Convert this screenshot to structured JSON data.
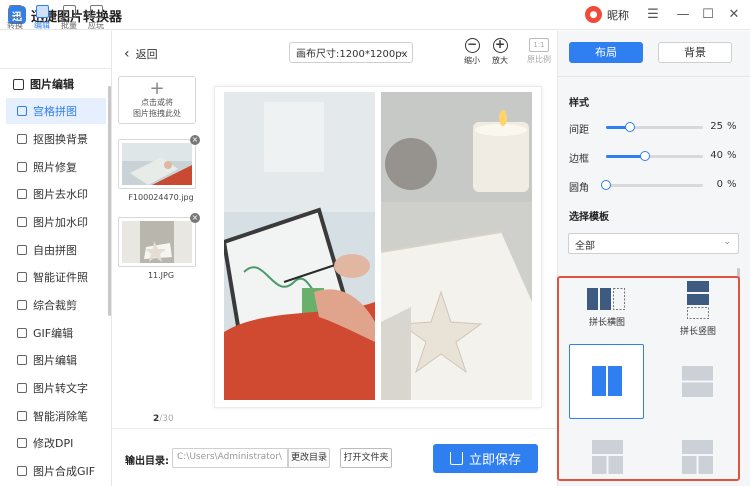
{
  "app": {
    "title": "迅捷图片转换器",
    "logo_glyph": "迅",
    "user_name": "昵称",
    "avatar_glyph": "●"
  },
  "window": {
    "menu_glyph": "☰",
    "minimize_glyph": "—",
    "maximize_glyph": "☐",
    "close_glyph": "✕"
  },
  "top_icons": [
    {
      "label": "转换",
      "icon": "convert-icon"
    },
    {
      "label": "编辑",
      "icon": "edit-icon",
      "active": true
    },
    {
      "label": "批量",
      "icon": "batch-icon"
    },
    {
      "label": "应玩",
      "icon": "fun-icon"
    }
  ],
  "sidebar": {
    "section_title": "图片编辑",
    "items": [
      {
        "label": "宫格拼图",
        "icon": "grid-icon",
        "active": true
      },
      {
        "label": "抠图换背景",
        "icon": "cutout-icon"
      },
      {
        "label": "照片修复",
        "icon": "repair-icon"
      },
      {
        "label": "图片去水印",
        "icon": "remove-watermark-icon"
      },
      {
        "label": "图片加水印",
        "icon": "add-watermark-icon"
      },
      {
        "label": "自由拼图",
        "icon": "free-collage-icon"
      },
      {
        "label": "智能证件照",
        "icon": "id-photo-icon"
      },
      {
        "label": "综合裁剪",
        "icon": "crop-icon"
      },
      {
        "label": "GIF编辑",
        "icon": "gif-icon"
      },
      {
        "label": "图片编辑",
        "icon": "image-edit-icon"
      },
      {
        "label": "图片转文字",
        "icon": "ocr-icon"
      },
      {
        "label": "智能消除笔",
        "icon": "eraser-icon"
      },
      {
        "label": "修改DPI",
        "icon": "dpi-icon"
      },
      {
        "label": "图片合成GIF",
        "icon": "make-gif-icon"
      }
    ]
  },
  "toolbar": {
    "back_label": "返回",
    "back_glyph": "‹",
    "canvas_size": "画布尺寸:1200*1200px",
    "chev": "⌄",
    "zoom_out_label": "缩小",
    "zoom_in_label": "放大",
    "ratio_box": "1:1",
    "ratio_label": "原比例",
    "minus": "−",
    "plus": "+"
  },
  "thumbnails": {
    "add_text": "点击或将\n图片拖拽此处",
    "plus": "+",
    "close": "×",
    "files": [
      "F100024470.jpg",
      "11.JPG"
    ],
    "page_current": "2",
    "page_total": "/30"
  },
  "output": {
    "label": "输出目录:",
    "path": "C:\\Users\\Administrator\\",
    "change_label": "更改目录",
    "open_label": "打开文件夹",
    "save_label": "立即保存"
  },
  "right": {
    "tab_layout": "布局",
    "tab_background": "背景",
    "style_title": "样式",
    "sliders": [
      {
        "label": "间距",
        "value": 25,
        "unit": "%"
      },
      {
        "label": "边框",
        "value": 40,
        "unit": "%"
      },
      {
        "label": "圆角",
        "value": 0,
        "unit": "%"
      }
    ],
    "template_title": "选择模板",
    "template_filter": "全部",
    "templates": [
      {
        "label": "拼长横图"
      },
      {
        "label": "拼长竖图"
      }
    ]
  },
  "colors": {
    "accent": "#2f7ff0",
    "highlight_border": "#e0533d"
  }
}
